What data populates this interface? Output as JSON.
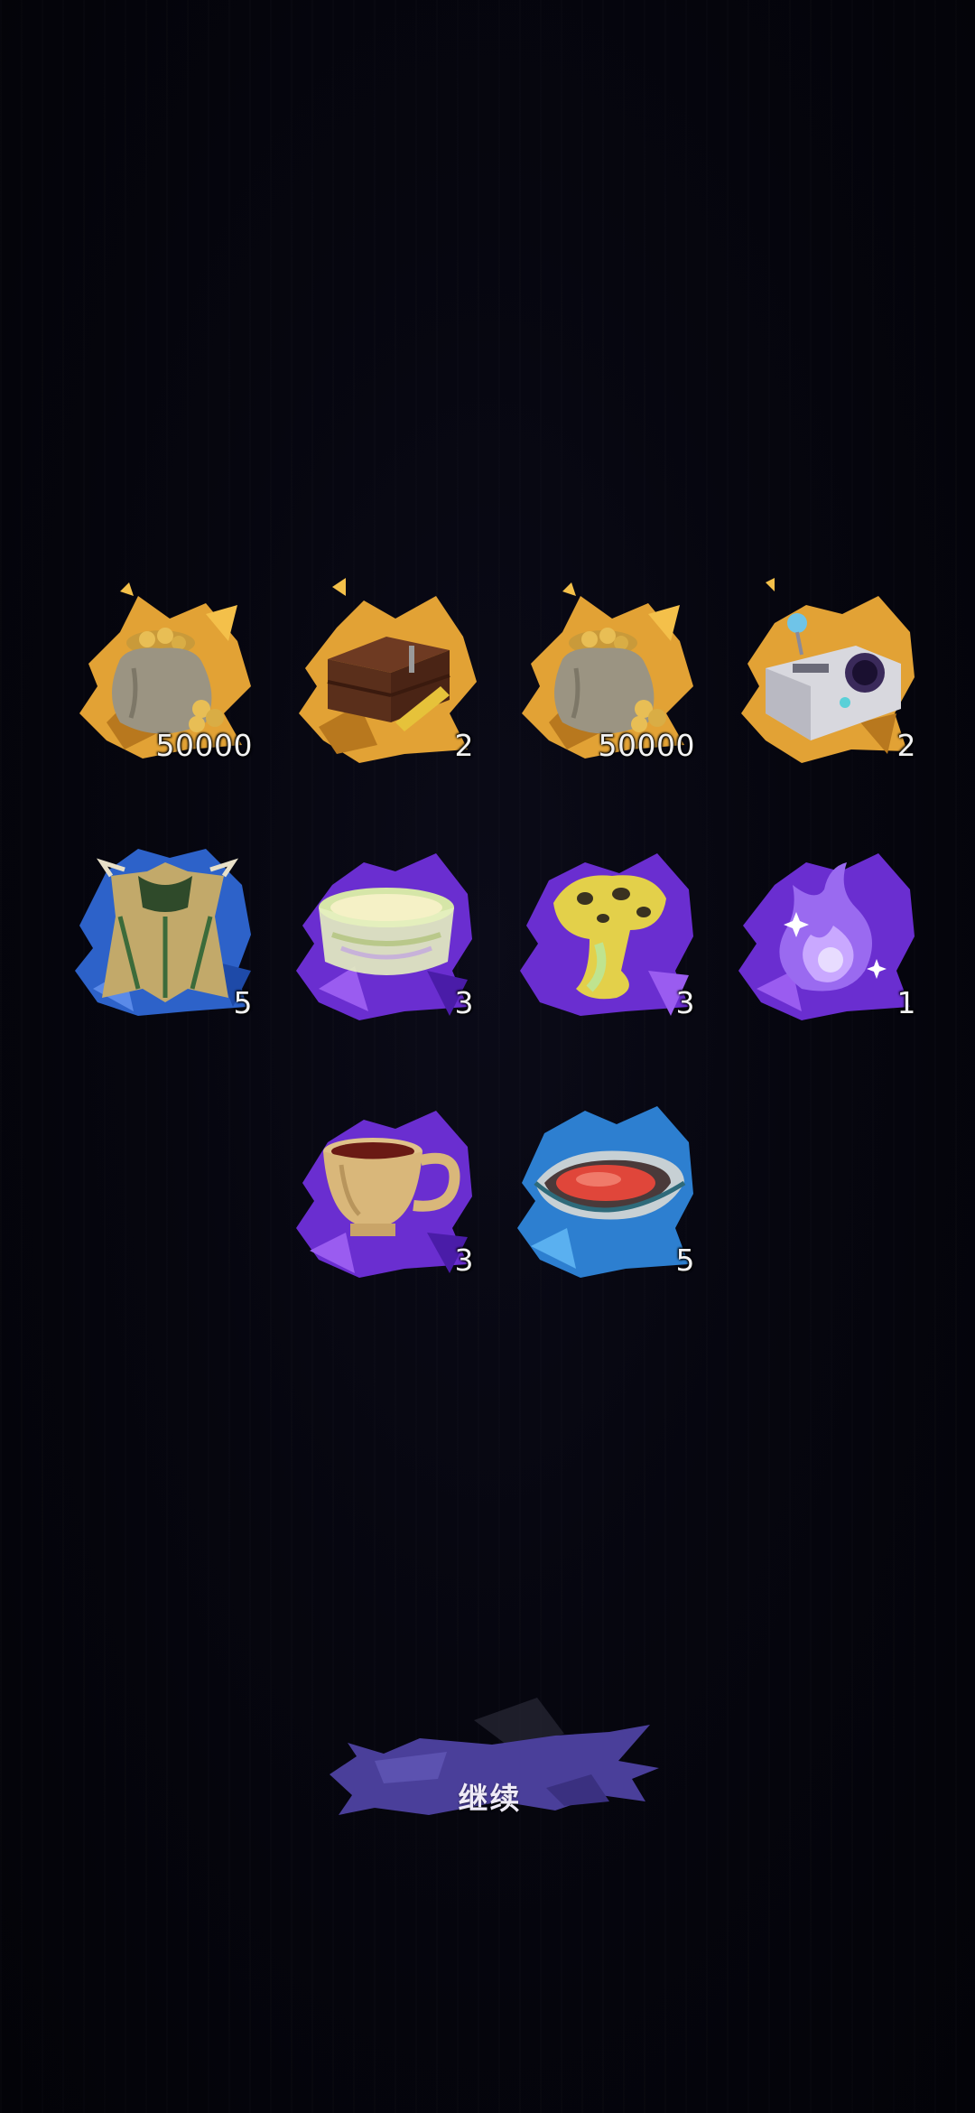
{
  "rewards": [
    {
      "name": "gold-coin-sack",
      "icon": "coin-sack-icon",
      "quantity": "50000",
      "rarity_color": "#e7a93a"
    },
    {
      "name": "treasure-chest",
      "icon": "chest-icon",
      "quantity": "2",
      "rarity_color": "#e7a93a"
    },
    {
      "name": "gold-coin-sack",
      "icon": "coin-sack-icon",
      "quantity": "50000",
      "rarity_color": "#e7a93a"
    },
    {
      "name": "console-device",
      "icon": "device-icon",
      "quantity": "2",
      "rarity_color": "#e7a93a"
    },
    {
      "name": "tattered-cloak",
      "icon": "cloak-icon",
      "quantity": "5",
      "rarity_color": "#2d62c9"
    },
    {
      "name": "crystal-jar",
      "icon": "jar-icon",
      "quantity": "3",
      "rarity_color": "#6a2ed0"
    },
    {
      "name": "spotted-fungus",
      "icon": "fungus-icon",
      "quantity": "3",
      "rarity_color": "#6a2ed0"
    },
    {
      "name": "spirit-flame",
      "icon": "spirit-flame-icon",
      "quantity": "1",
      "rarity_color": "#6a2ed0"
    },
    {
      "name": "wooden-cup",
      "icon": "cup-icon",
      "quantity": "3",
      "rarity_color": "#6a2ed0"
    },
    {
      "name": "oyster-dish",
      "icon": "oyster-icon",
      "quantity": "5",
      "rarity_color": "#2d7fd0"
    }
  ],
  "continue_button": {
    "label": "继续",
    "color": "#4a3f9a"
  }
}
